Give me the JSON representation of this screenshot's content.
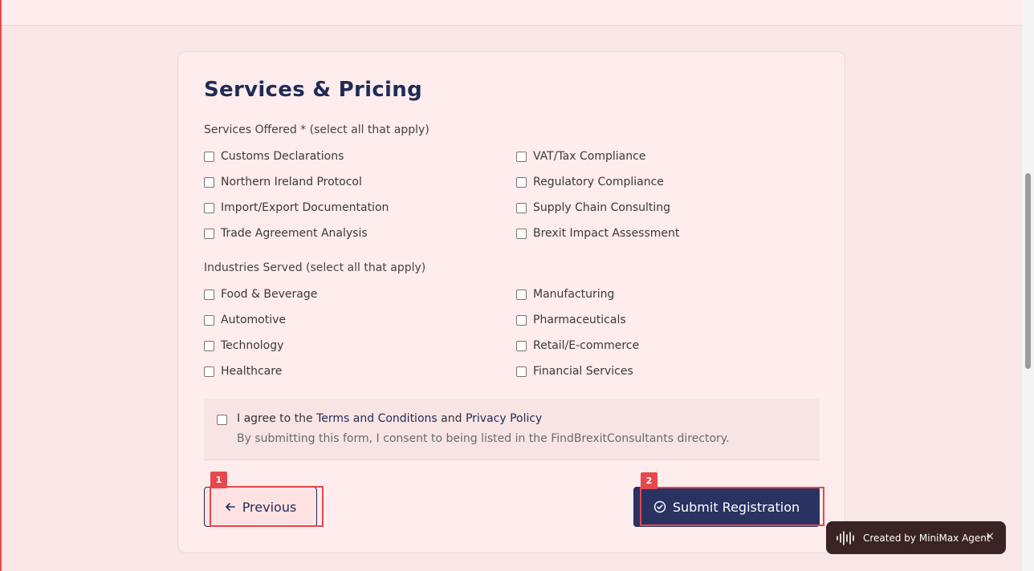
{
  "form": {
    "section_title": "Services & Pricing",
    "services_label": "Services Offered * (select all that apply)",
    "services": [
      "Customs Declarations",
      "VAT/Tax Compliance",
      "Northern Ireland Protocol",
      "Regulatory Compliance",
      "Import/Export Documentation",
      "Supply Chain Consulting",
      "Trade Agreement Analysis",
      "Brexit Impact Assessment"
    ],
    "industries_label": "Industries Served (select all that apply)",
    "industries": [
      "Food & Beverage",
      "Manufacturing",
      "Automotive",
      "Pharmaceuticals",
      "Technology",
      "Retail/E-commerce",
      "Healthcare",
      "Financial Services"
    ],
    "consent": {
      "prefix": "I agree to the",
      "terms_link": "Terms and Conditions",
      "and": "and",
      "privacy_link": "Privacy Policy",
      "note": "By submitting this form, I consent to being listed in the FindBrexitConsultants directory."
    },
    "previous_label": "Previous",
    "submit_label": "Submit Registration"
  },
  "markers": {
    "previous": "1",
    "submit": "2"
  },
  "toast": {
    "text": "Created by MiniMax Agent",
    "close": "×"
  },
  "colors": {
    "accent": "#e5484d",
    "navy": "#1d2c57",
    "submit_bg": "#2a3262"
  }
}
